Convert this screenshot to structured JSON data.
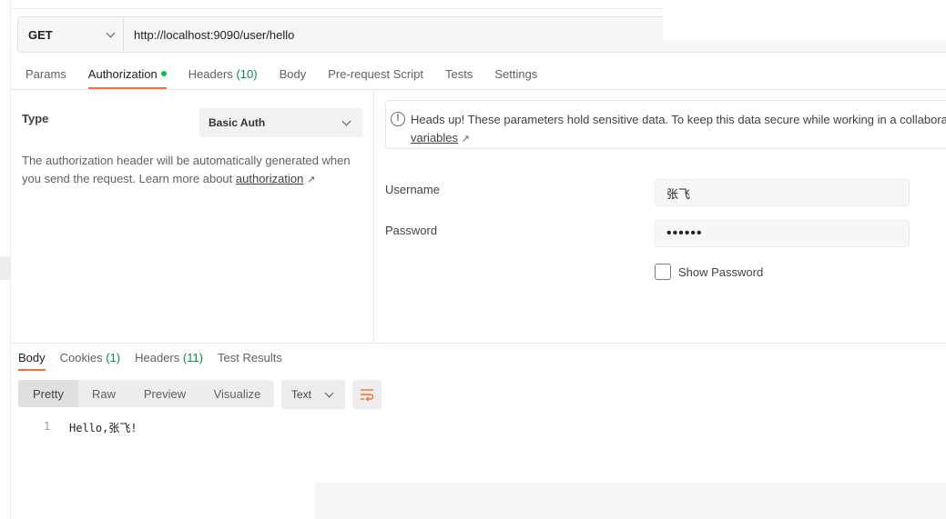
{
  "request": {
    "method": "GET",
    "url": "http://localhost:9090/user/hello"
  },
  "request_tabs": [
    {
      "label": "Params",
      "count": ""
    },
    {
      "label": "Authorization",
      "count": ""
    },
    {
      "label": "Headers",
      "count": "(10)"
    },
    {
      "label": "Body",
      "count": ""
    },
    {
      "label": "Pre-request Script",
      "count": ""
    },
    {
      "label": "Tests",
      "count": ""
    },
    {
      "label": "Settings",
      "count": ""
    }
  ],
  "auth": {
    "type_label": "Type",
    "type_value": "Basic Auth",
    "description": "The authorization header will be automatically generated when you send the request. Learn more about",
    "description_link": "authorization",
    "notice_text": "Heads up! These parameters hold sensitive data. To keep this data secure while working in a collaborati",
    "notice_link": "variables",
    "username_label": "Username",
    "username_value": "张飞",
    "password_label": "Password",
    "password_value": "••••••",
    "show_password_label": "Show Password"
  },
  "response_tabs": [
    {
      "label": "Body",
      "count": ""
    },
    {
      "label": "Cookies",
      "count": "(1)"
    },
    {
      "label": "Headers",
      "count": "(11)"
    },
    {
      "label": "Test Results",
      "count": ""
    }
  ],
  "view_modes": [
    "Pretty",
    "Raw",
    "Preview",
    "Visualize"
  ],
  "format_value": "Text",
  "response_body": {
    "line_number": "1",
    "content": "Hello,张飞!"
  },
  "colors": {
    "accent": "#ff6c37",
    "count_green": "#0c8a4b",
    "dot_green": "#0cbb52"
  }
}
